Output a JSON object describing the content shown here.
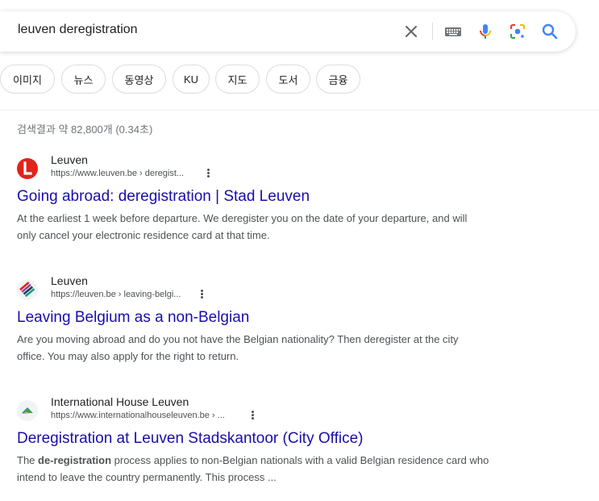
{
  "search": {
    "query": "leuven deregistration"
  },
  "tabs": [
    {
      "label": "이미지"
    },
    {
      "label": "뉴스"
    },
    {
      "label": "동영상"
    },
    {
      "label": "KU"
    },
    {
      "label": "지도"
    },
    {
      "label": "도서"
    },
    {
      "label": "금융"
    }
  ],
  "stats": "검색결과 약 82,800개 (0.34초)",
  "results": [
    {
      "site_name": "Leuven",
      "url": "https://www.leuven.be › deregist...",
      "title": "Going abroad: deregistration | Stad Leuven",
      "snippet_line1": "At the earliest 1 week before departure. We deregister you on the date of your departure, and will",
      "snippet_line2": "only cancel your electronic residence card at that time.",
      "favicon_color": "#e2231a"
    },
    {
      "site_name": "Leuven",
      "url": "https://leuven.be › leaving-belgi...",
      "title": "Leaving Belgium as a non-Belgian",
      "snippet_line1": "Are you moving abroad and do you not have the Belgian nationality? Then deregister at the city",
      "snippet_line2": "office. You may also apply for the right to return."
    },
    {
      "site_name": "International House Leuven",
      "url": "https://www.internationalhouseleuven.be › ...",
      "title": "Deregistration at Leuven Stadskantoor (City Office)",
      "snippet_bold": "de-registration",
      "snippet_pre": "The ",
      "snippet_post": " process applies to non-Belgian nationals with a valid Belgian residence card who",
      "snippet_line2": "intend to leave the country permanently. This process ..."
    }
  ],
  "colors": {
    "link": "#1a0dab",
    "mic_blue": "#4285f4",
    "mic_yellow": "#fbbc04",
    "search_blue": "#4285f4"
  },
  "icons": [
    "clear-icon",
    "keyboard-icon",
    "mic-icon",
    "lens-icon",
    "search-icon",
    "more-options-icon"
  ]
}
